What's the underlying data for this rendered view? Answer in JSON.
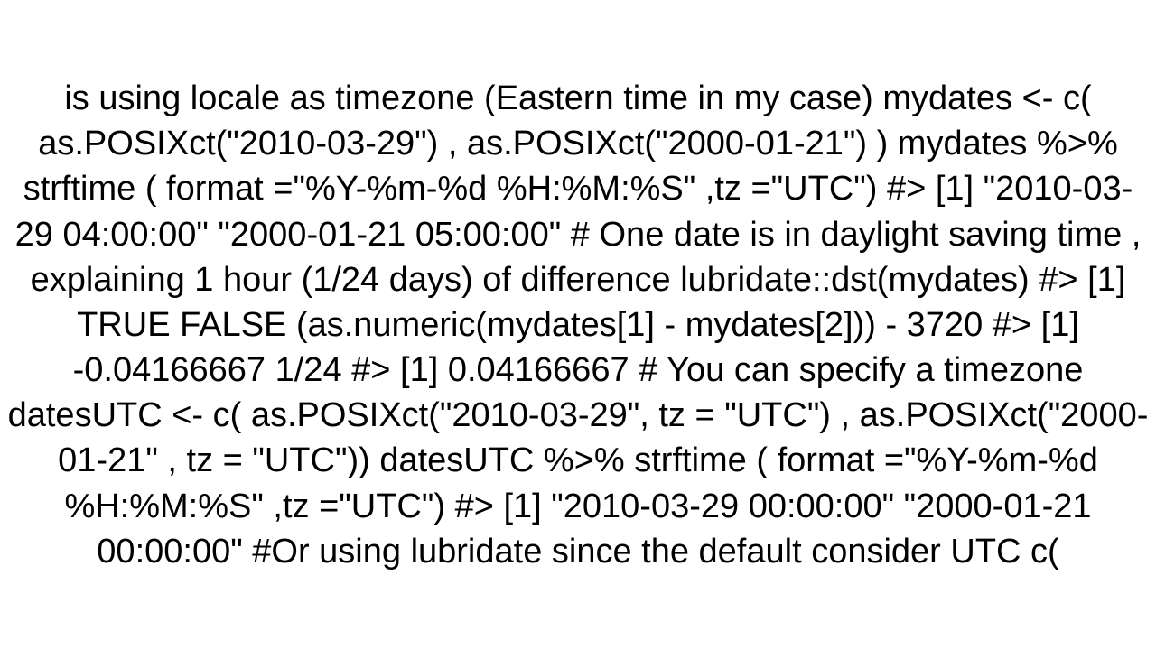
{
  "content": {
    "main_text": "is using locale as timezone (Eastern time in my case) mydates <- c( as.POSIXct(\"2010-03-29\") , as.POSIXct(\"2000-01-21\") ) mydates %>% strftime ( format =\"%Y-%m-%d %H:%M:%S\" ,tz =\"UTC\") #> [1] \"2010-03-29 04:00:00\" \"2000-01-21 05:00:00\"  # One date is in daylight saving time , explaining 1 hour (1/24 days) of difference lubridate::dst(mydates) #> [1]  TRUE FALSE (as.numeric(mydates[1] - mydates[2])) - 3720 #> [1] -0.04166667  1/24 #> [1] 0.04166667   # You can specify a timezone datesUTC <-  c( as.POSIXct(\"2010-03-29\", tz = \"UTC\") , as.POSIXct(\"2000-01-21\" , tz = \"UTC\")) datesUTC %>% strftime ( format =\"%Y-%m-%d %H:%M:%S\" ,tz =\"UTC\") #> [1] \"2010-03-29 00:00:00\" \"2000-01-21 00:00:00\"  #Or using lubridate since the default consider UTC c("
  }
}
